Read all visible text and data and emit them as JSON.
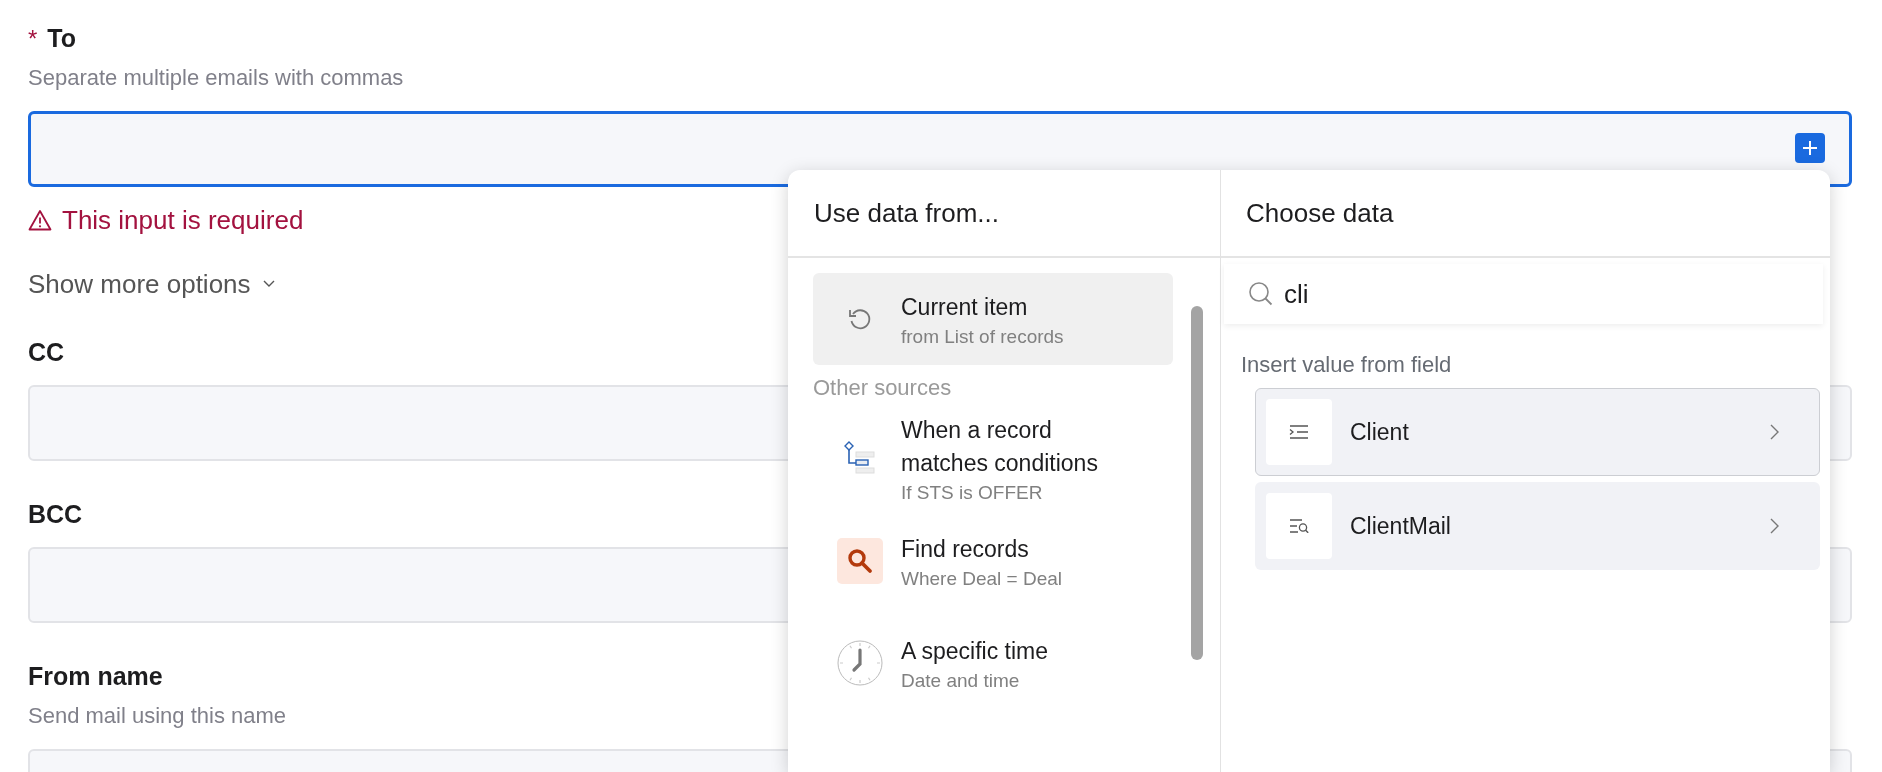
{
  "fields": [
    {
      "label": "To",
      "required": true,
      "required_mark": "*",
      "helper": "Separate multiple emails with commas",
      "focused": true,
      "has_insert_button": true,
      "error": "This input is required"
    },
    {
      "label": "CC",
      "required": false,
      "focused": false,
      "has_insert_button": false
    },
    {
      "label": "BCC",
      "required": false,
      "focused": false,
      "has_insert_button": false
    },
    {
      "label": "From name",
      "required": false,
      "helper": "Send mail using this name",
      "focused": false,
      "has_insert_button": false
    }
  ],
  "more_options": {
    "label": "Show more options",
    "expanded": false
  },
  "popup": {
    "sources": {
      "title": "Use data from...",
      "current": {
        "kind": "current",
        "title": "Current item",
        "subtitle": "from List of records",
        "selected": true
      },
      "section": "Other sources",
      "items": [
        {
          "kind": "condition",
          "title": "When a record matches conditions",
          "subtitle": "If STS is OFFER",
          "selected": false
        },
        {
          "kind": "find",
          "title": "Find records",
          "subtitle": "Where Deal = Deal",
          "selected": false
        },
        {
          "kind": "time",
          "title": "A specific time",
          "subtitle": "Date and time",
          "selected": false
        }
      ]
    },
    "choose": {
      "title": "Choose data",
      "search": {
        "value": "cli"
      },
      "section": "Insert value from field",
      "fields": [
        {
          "kind": "text",
          "name": "Client",
          "selected": true
        },
        {
          "kind": "lookup",
          "name": "ClientMail",
          "selected": false
        }
      ]
    }
  }
}
